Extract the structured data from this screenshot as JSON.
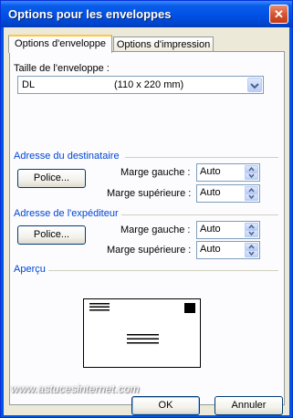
{
  "window": {
    "title": "Options pour les enveloppes",
    "close_label": "✕"
  },
  "tabs": [
    {
      "label": "Options d'enveloppe",
      "active": true
    },
    {
      "label": "Options d'impression",
      "active": false
    }
  ],
  "envelope_size": {
    "label": "Taille de l'enveloppe :",
    "name": "DL",
    "dimensions": "(110 x 220 mm)"
  },
  "recipient": {
    "section": "Adresse du destinataire",
    "font_button": "Police...",
    "left_margin_label": "Marge gauche :",
    "left_margin_value": "Auto",
    "top_margin_label": "Marge supérieure :",
    "top_margin_value": "Auto"
  },
  "sender": {
    "section": "Adresse de l'expéditeur",
    "font_button": "Police...",
    "left_margin_label": "Marge gauche :",
    "left_margin_value": "Auto",
    "top_margin_label": "Marge supérieure :",
    "top_margin_value": "Auto"
  },
  "preview": {
    "section": "Aperçu"
  },
  "watermark": "www.astucesinternet.com",
  "footer": {
    "ok": "OK",
    "cancel": "Annuler"
  },
  "colors": {
    "title_blue": "#0054e3",
    "section_blue": "#0046d5",
    "tab_highlight": "#ffc83c"
  }
}
